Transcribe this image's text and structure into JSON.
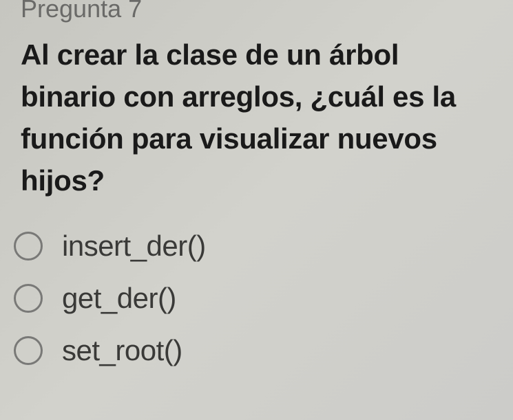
{
  "question": {
    "number": "Pregunta 7",
    "text": "Al crear la clase de un árbol binario con arreglos, ¿cuál es la función para visualizar nuevos hijos?"
  },
  "options": [
    {
      "label": "insert_der()"
    },
    {
      "label": "get_der()"
    },
    {
      "label": "set_root()"
    }
  ]
}
